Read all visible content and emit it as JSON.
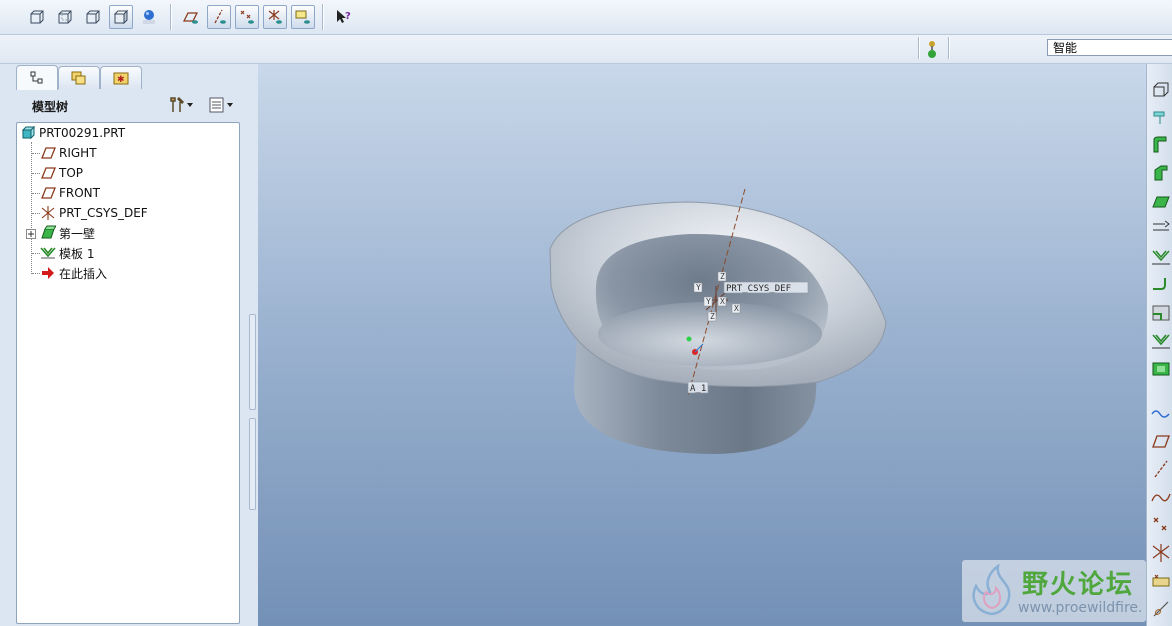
{
  "statusbar": {
    "filter_value": "智能"
  },
  "model_tree": {
    "title": "模型树",
    "items": [
      {
        "label": "PRT00291.PRT",
        "icon": "part-icon"
      },
      {
        "label": "RIGHT",
        "icon": "datum-plane-icon"
      },
      {
        "label": "TOP",
        "icon": "datum-plane-icon"
      },
      {
        "label": "FRONT",
        "icon": "datum-plane-icon"
      },
      {
        "label": "PRT_CSYS_DEF",
        "icon": "csys-icon"
      },
      {
        "label": "第一壁",
        "icon": "sheetmetal-wall-icon"
      },
      {
        "label": "模板 1",
        "icon": "form-icon"
      },
      {
        "label": "在此插入",
        "icon": "insert-here-arrow-icon"
      }
    ]
  },
  "viewport": {
    "csys_label": "PRT_CSYS_DEF",
    "axis_label_a": "A_1",
    "colors": {
      "part": "#9aa6b4",
      "bg_top": "#c9d8ea",
      "bg_bottom": "#7390b6"
    }
  },
  "watermark": {
    "title": "野火论坛",
    "url": "www.proewildfire."
  }
}
